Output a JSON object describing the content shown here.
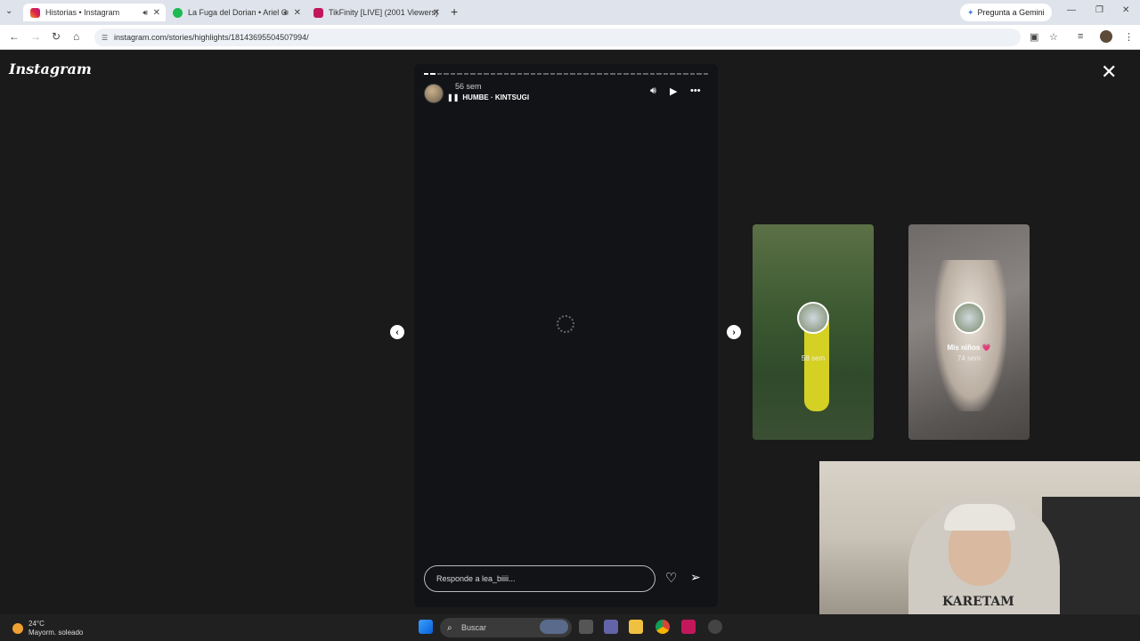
{
  "browser": {
    "tabs": [
      {
        "title": "Historias • Instagram",
        "active": true
      },
      {
        "title": "La Fuga del Dorian • Ariel C",
        "active": false
      },
      {
        "title": "TikFinity [LIVE] (2001 Viewers)",
        "active": false
      }
    ],
    "gemini_label": "Pregunta a Gemini",
    "url": "instagram.com/stories/highlights/18143695504507994/"
  },
  "instagram": {
    "logo": "Instagram",
    "story": {
      "time": "56 sem",
      "music": "HUMBE · KINTSUGI",
      "reply_placeholder": "Responde a lea_biiii..."
    },
    "next_highlights": [
      {
        "label": "",
        "sub": "58 sem"
      },
      {
        "label": "Mis niños 💗",
        "sub": "74 sem"
      }
    ]
  },
  "webcam": {
    "shirt_text": "KARETAM"
  },
  "taskbar": {
    "temperature": "24°C",
    "condition": "Mayorm. soleado",
    "search_label": "Buscar"
  },
  "colors": {
    "page_bg": "#1a1a1a",
    "story_bg": "#121316",
    "taskbar_bg": "#202020"
  }
}
